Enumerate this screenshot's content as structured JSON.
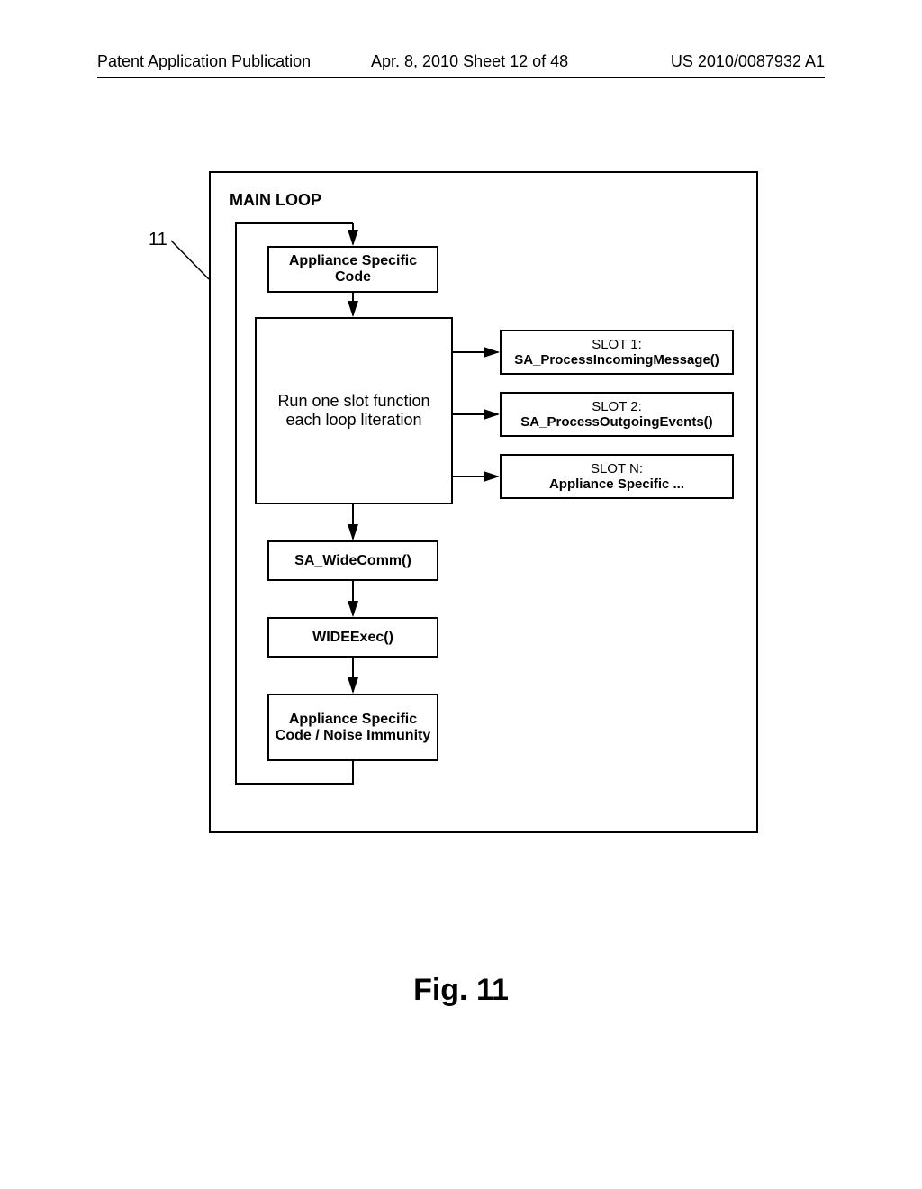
{
  "header": {
    "left": "Patent Application Publication",
    "mid": "Apr. 8, 2010  Sheet 12 of 48",
    "right": "US 2010/0087932 A1"
  },
  "ref_number": "11",
  "loop_title": "MAIN LOOP",
  "boxes": {
    "step1": "Appliance Specific Code",
    "step2": "Run one slot function each loop literation",
    "step3": "SA_WideComm()",
    "step4": "WIDEExec()",
    "step5": "Appliance Specific Code / Noise Immunity",
    "slot1_l1": "SLOT 1:",
    "slot1_l2": "SA_ProcessIncomingMessage()",
    "slot2_l1": "SLOT 2:",
    "slot2_l2": "SA_ProcessOutgoingEvents()",
    "slotn_l1": "SLOT N:",
    "slotn_l2": "Appliance Specific ..."
  },
  "caption": "Fig. 11"
}
